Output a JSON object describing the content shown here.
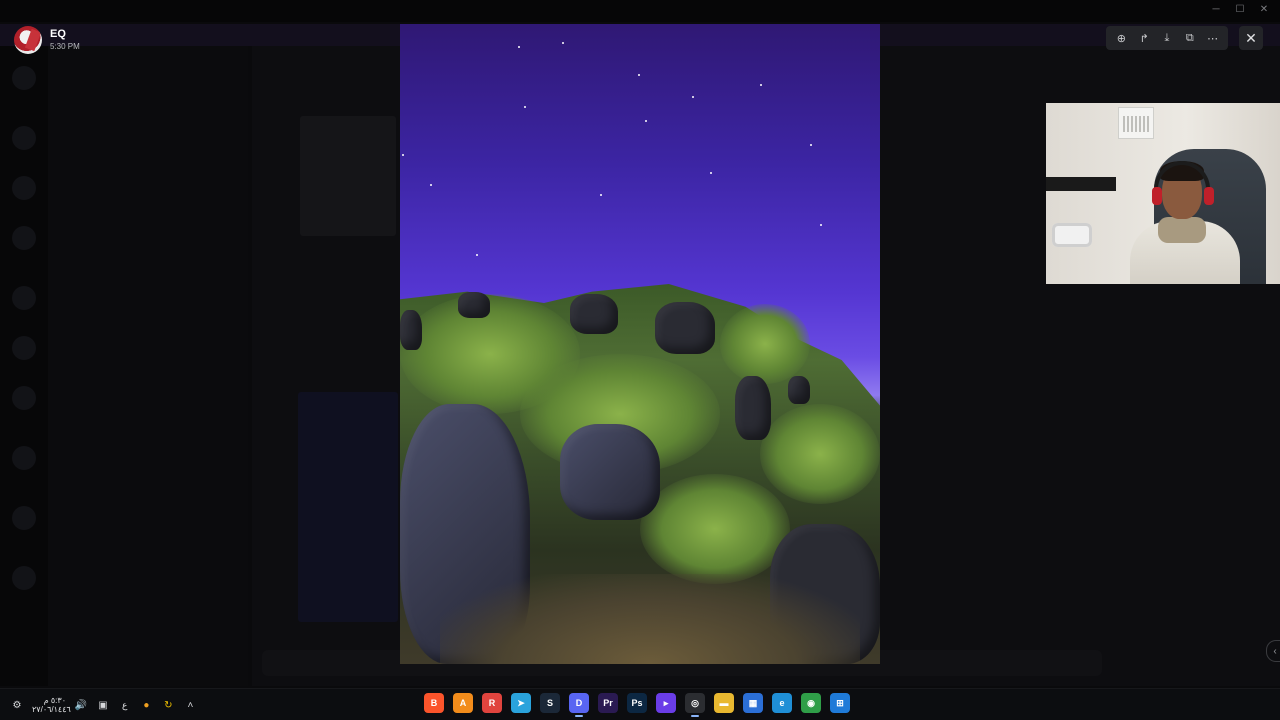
{
  "viewer": {
    "user_name": "EQ",
    "timestamp": "5:30 PM",
    "toolbar": [
      {
        "icon": "zoom-in-icon",
        "glyph": "⊕"
      },
      {
        "icon": "forward-icon",
        "glyph": "↱"
      },
      {
        "icon": "download-icon",
        "glyph": "⤓"
      },
      {
        "icon": "open-external-icon",
        "glyph": "⧉"
      },
      {
        "icon": "more-icon",
        "glyph": "⋯"
      }
    ],
    "close_glyph": "✕"
  },
  "window_controls": {
    "minimize": "─",
    "maximize": "☐",
    "close": "✕"
  },
  "taskbar": {
    "clock_time": "٥:٣٠ م",
    "clock_date": "٢٧/٠٦/١٤٤٦",
    "language": "ع",
    "tray_glyphs": [
      "⚙",
      "🔊",
      "▣"
    ],
    "apps": [
      {
        "name": "brave",
        "glyph": "B",
        "color": "#fb542b"
      },
      {
        "name": "affinity",
        "glyph": "A",
        "color": "#f28c1b"
      },
      {
        "name": "revo",
        "glyph": "R",
        "color": "#e0443e"
      },
      {
        "name": "telegram",
        "glyph": "➤",
        "color": "#2aa3dc"
      },
      {
        "name": "steam",
        "glyph": "S",
        "color": "#1b2838"
      },
      {
        "name": "discord",
        "glyph": "D",
        "color": "#5865f2"
      },
      {
        "name": "premiere",
        "glyph": "Pr",
        "color": "#2a1a52"
      },
      {
        "name": "photoshop",
        "glyph": "Ps",
        "color": "#0c2742"
      },
      {
        "name": "editor",
        "glyph": "▸",
        "color": "#6a3de8"
      },
      {
        "name": "obs",
        "glyph": "◎",
        "color": "#2b2d31"
      },
      {
        "name": "file-explorer",
        "glyph": "▬",
        "color": "#e8b830"
      },
      {
        "name": "store",
        "glyph": "▦",
        "color": "#2b6fd6"
      },
      {
        "name": "edge",
        "glyph": "e",
        "color": "#1f8fd6"
      },
      {
        "name": "chrome",
        "glyph": "◉",
        "color": "#2f9e48"
      },
      {
        "name": "start",
        "glyph": "⊞",
        "color": "#1f7ad8"
      }
    ]
  },
  "colors": {
    "sky_top": "#2f1874",
    "sky_mid": "#5536d2",
    "viewer_toolbar": "#232428"
  }
}
